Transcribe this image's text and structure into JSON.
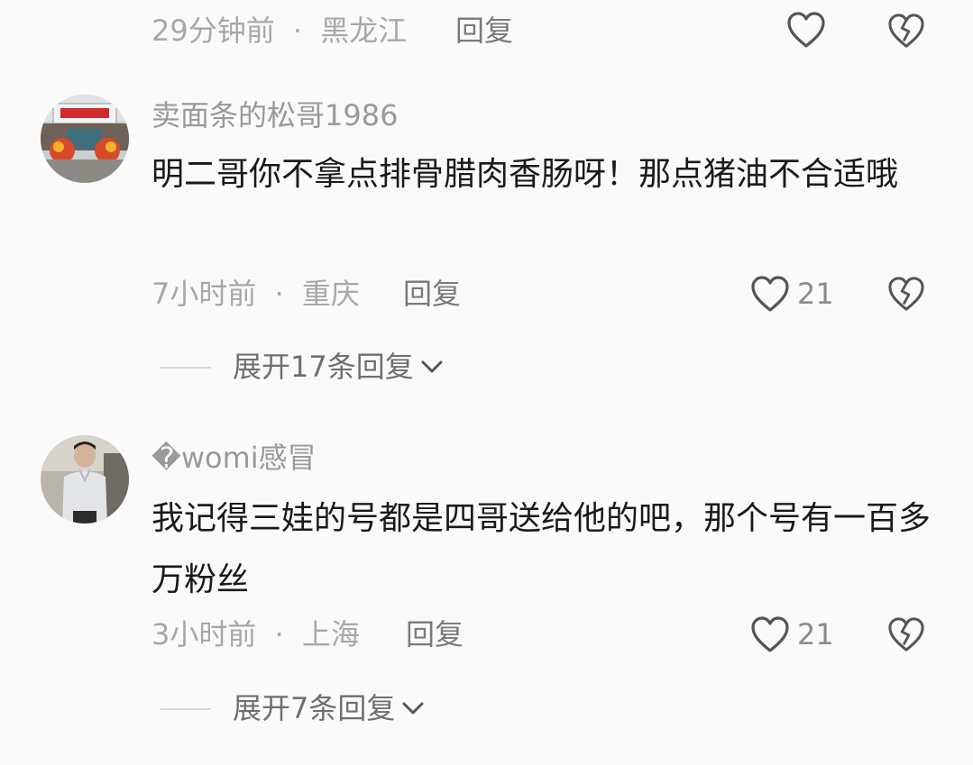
{
  "top": {
    "time": "29分钟前",
    "sep": "·",
    "location": "黑龙江",
    "reply_label": "回复"
  },
  "comments": [
    {
      "username": "卖面条的松哥1986",
      "text": "明二哥你不拿点排骨腊肉香肠呀！那点猪油不合适哦",
      "time": "7小时前",
      "sep": "·",
      "location": "重庆",
      "reply_label": "回复",
      "likes": "21",
      "expand": "展开17条回复"
    },
    {
      "username": "�womi感冒",
      "text": "我记得三娃的号都是四哥送给他的吧，那个号有一百多万粉丝",
      "time": "3小时前",
      "sep": "·",
      "location": "上海",
      "reply_label": "回复",
      "likes": "21",
      "expand": "展开7条回复"
    }
  ],
  "colors": {
    "background": "#fafafa",
    "text": "#1a1a1a",
    "muted": "#a8a8a8",
    "icon": "#555555"
  }
}
